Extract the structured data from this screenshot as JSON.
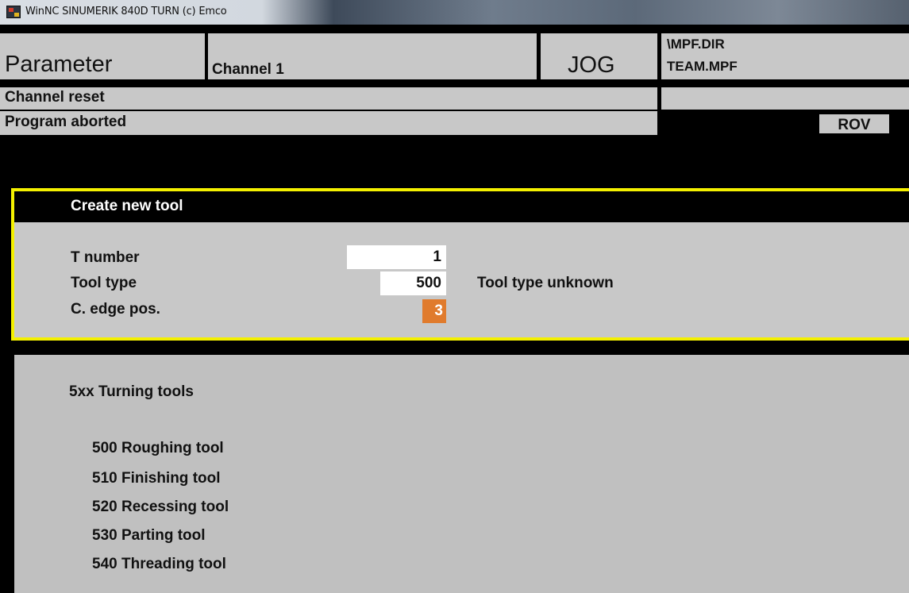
{
  "window": {
    "title": "WinNC SINUMERIK 840D TURN (c) Emco",
    "icon": "app-icon"
  },
  "header": {
    "area": "Parameter",
    "channel": "Channel 1",
    "mode": "JOG",
    "program_dir": "\\MPF.DIR",
    "program_name": "TEAM.MPF"
  },
  "status": {
    "channel_state": "Channel reset",
    "program_state": "Program aborted",
    "rov": "ROV"
  },
  "dialog": {
    "title": "Create new tool",
    "fields": {
      "t_number": {
        "label": "T number",
        "value": "1"
      },
      "tool_type": {
        "label": "Tool type",
        "value": "500",
        "message": "Tool type unknown"
      },
      "edge_pos": {
        "label": "C. edge pos.",
        "value": "3"
      }
    }
  },
  "info": {
    "heading": "5xx Turning tools",
    "items": [
      "500 Roughing tool",
      "510 Finishing tool",
      "520 Recessing tool",
      "530 Parting tool",
      "540 Threading tool"
    ]
  },
  "colors": {
    "panel": "#c8c8c8",
    "dialog_border": "#f4f000",
    "active_field": "#e07b2d",
    "background": "#000000"
  }
}
